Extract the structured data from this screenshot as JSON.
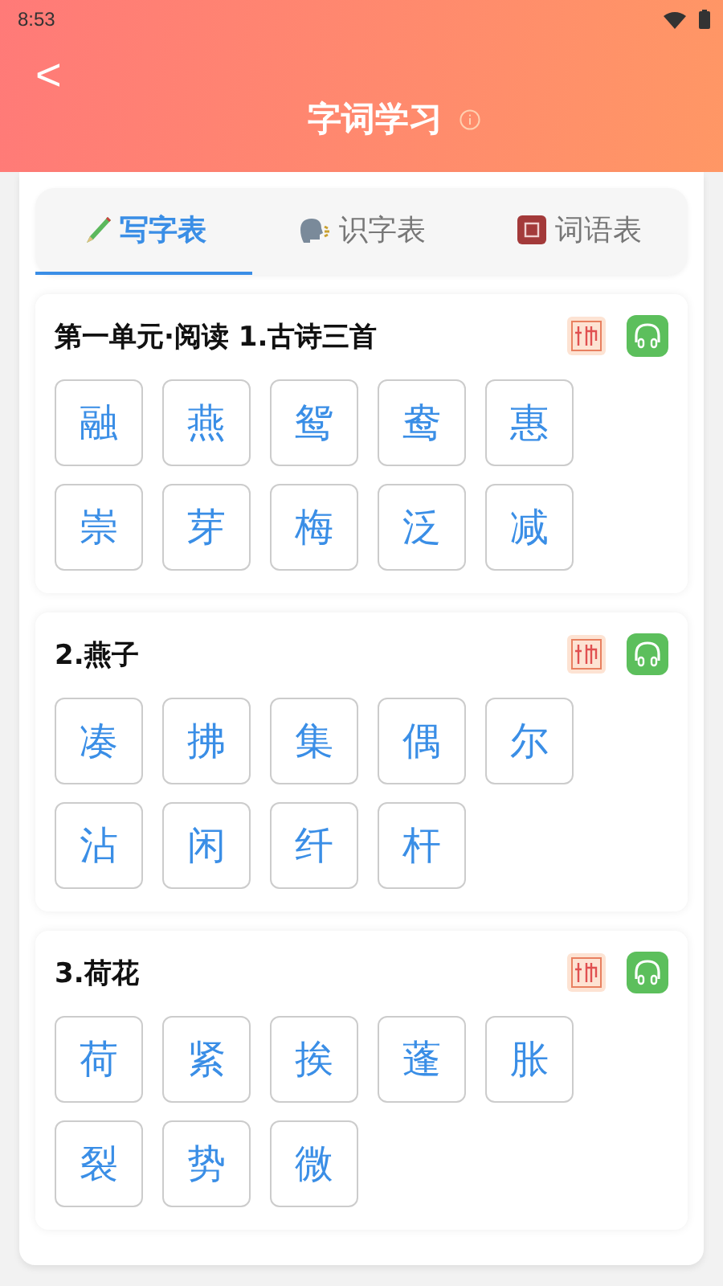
{
  "status_bar": {
    "time": "8:53"
  },
  "header": {
    "back": "<",
    "title": "字词学习"
  },
  "tabs": [
    {
      "label": "写字表",
      "selected": true
    },
    {
      "label": "识字表",
      "selected": false
    },
    {
      "label": "词语表",
      "selected": false
    }
  ],
  "sections": [
    {
      "title": "第一单元·阅读 1.古诗三首",
      "characters": [
        "融",
        "燕",
        "鸳",
        "鸯",
        "惠",
        "崇",
        "芽",
        "梅",
        "泛",
        "减"
      ]
    },
    {
      "title": "2.燕子",
      "characters": [
        "凑",
        "拂",
        "集",
        "偶",
        "尔",
        "沾",
        "闲",
        "纤",
        "杆"
      ]
    },
    {
      "title": "3.荷花",
      "characters": [
        "荷",
        "紧",
        "挨",
        "蓬",
        "胀",
        "裂",
        "势",
        "微"
      ]
    }
  ]
}
